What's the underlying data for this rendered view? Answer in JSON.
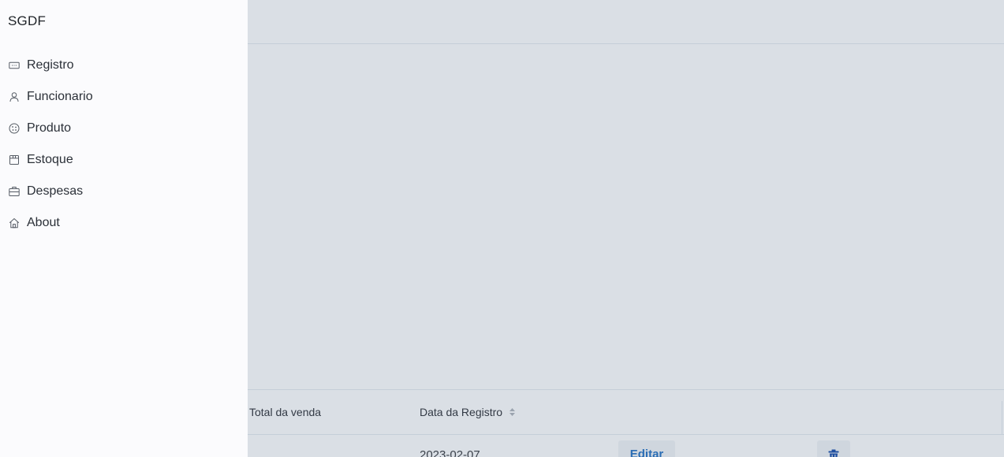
{
  "app": {
    "brand": "SGDF"
  },
  "sidebar": {
    "items": [
      {
        "label": "Registro",
        "icon": "ticket-icon"
      },
      {
        "label": "Funcionario",
        "icon": "user-icon"
      },
      {
        "label": "Produto",
        "icon": "cookie-icon"
      },
      {
        "label": "Estoque",
        "icon": "calendar-icon"
      },
      {
        "label": "Despesas",
        "icon": "briefcase-icon"
      },
      {
        "label": "About",
        "icon": "home-icon"
      }
    ]
  },
  "table": {
    "columns": {
      "total": "Total da venda",
      "date": "Data da Registro"
    },
    "rows": [
      {
        "date": "2023-02-07",
        "edit_label": "Editar",
        "delete_icon": "trash-icon"
      }
    ]
  },
  "colors": {
    "sidebar_bg": "#fbfbfd",
    "page_bg": "#dadfe5",
    "accent": "#2a6db5"
  }
}
